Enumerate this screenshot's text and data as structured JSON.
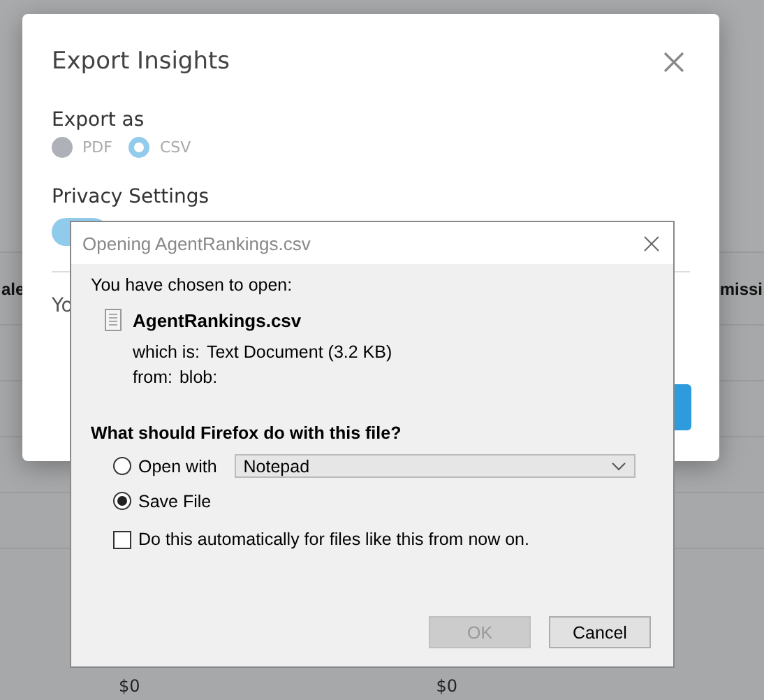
{
  "background": {
    "columns": [
      {
        "label": "ale"
      },
      {
        "label": "missi"
      }
    ],
    "values": [
      "$0",
      "$0"
    ]
  },
  "export_modal": {
    "title": "Export Insights",
    "export_as": {
      "label": "Export as",
      "options": [
        {
          "label": "PDF",
          "selected": false
        },
        {
          "label": "CSV",
          "selected": true
        }
      ]
    },
    "privacy": {
      "label": "Privacy Settings",
      "toggle_on": true
    },
    "note": "Yo"
  },
  "download_dialog": {
    "title": "Opening AgentRankings.csv",
    "intro": "You have chosen to open:",
    "file_name": "AgentRankings.csv",
    "details": [
      {
        "label": "which is:",
        "value": "Text Document (3.2 KB)"
      },
      {
        "label": "from:",
        "value": "blob:"
      }
    ],
    "question": "What should Firefox do with this file?",
    "actions": [
      {
        "label": "Open with",
        "selected": false,
        "app": "Notepad"
      },
      {
        "label": "Save File",
        "selected": true
      }
    ],
    "remember": {
      "label": "Do this automatically for files like this from now on.",
      "checked": false
    },
    "buttons": [
      {
        "label": "OK",
        "disabled": true
      },
      {
        "label": "Cancel",
        "disabled": false
      }
    ]
  }
}
